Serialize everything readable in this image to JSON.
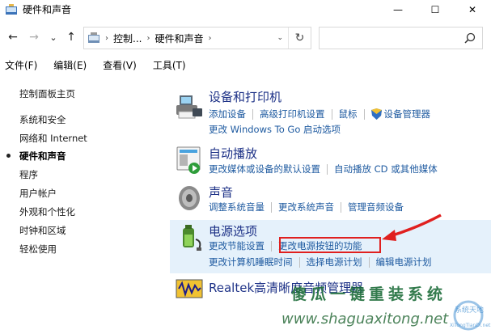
{
  "window": {
    "title": "硬件和声音",
    "minimize": "—",
    "maximize": "☐",
    "close": "✕"
  },
  "nav": {
    "back": "←",
    "forward": "→",
    "recent": "⌄",
    "up": "↑",
    "crumbs": [
      "控制...",
      "硬件和声音"
    ],
    "crumb_sep": "›",
    "dropdown": "⌄",
    "refresh": "↻"
  },
  "menu": [
    "文件(F)",
    "编辑(E)",
    "查看(V)",
    "工具(T)"
  ],
  "left": {
    "items": [
      "控制面板主页",
      "系统和安全",
      "网络和 Internet",
      "硬件和声音",
      "程序",
      "用户帐户",
      "外观和个性化",
      "时钟和区域",
      "轻松使用"
    ],
    "active_index": 3
  },
  "categories": [
    {
      "title": "设备和打印机",
      "icon": "printer-icon",
      "rows": [
        [
          "添加设备",
          "高级打印机设置",
          "鼠标",
          "设备管理器"
        ],
        [
          "更改 Windows To Go 启动选项"
        ]
      ]
    },
    {
      "title": "自动播放",
      "icon": "autoplay-icon",
      "rows": [
        [
          "更改媒体或设备的默认设置",
          "自动播放 CD 或其他媒体"
        ]
      ]
    },
    {
      "title": "声音",
      "icon": "speaker-icon",
      "rows": [
        [
          "调整系统音量",
          "更改系统声音",
          "管理音频设备"
        ]
      ]
    },
    {
      "title": "电源选项",
      "icon": "power-icon",
      "rows": [
        [
          "更改节能设置",
          "更改电源按钮的功能"
        ],
        [
          "更改计算机睡眠时间",
          "选择电源计划",
          "编辑电源计划"
        ]
      ]
    },
    {
      "title": "Realtek高清晰度音频管理器",
      "icon": "realtek-icon",
      "rows": []
    }
  ],
  "watermark": {
    "title": "傻瓜一键重装系统",
    "url": "www.shaguaxitong.net",
    "logo_text": "系统天地",
    "logo_sub": "XiTongTianDi.net"
  },
  "colors": {
    "link": "#1e5aa0",
    "title": "#1e3287",
    "highlight": "#e5f1fb",
    "annotation": "#e0201f"
  }
}
